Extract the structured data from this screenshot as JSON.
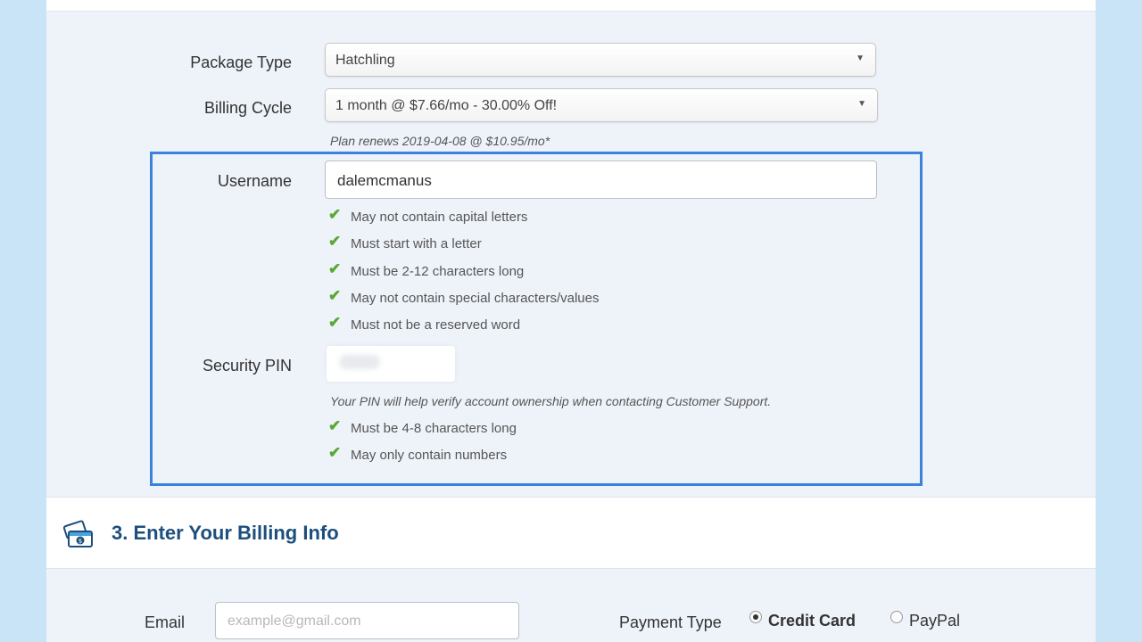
{
  "form": {
    "package_type_label": "Package Type",
    "package_type_value": "Hatchling",
    "billing_cycle_label": "Billing Cycle",
    "billing_cycle_value": "1 month @ $7.66/mo - 30.00% Off!",
    "renew_note": "Plan renews 2019-04-08 @ $10.95/mo*",
    "dropdown_glyph": "▼"
  },
  "account": {
    "username_label": "Username",
    "username_value": "dalemcmanus",
    "username_rules": [
      "May not contain capital letters",
      "Must start with a letter",
      "Must be 2-12 characters long",
      "May not contain special characters/values",
      "Must not be a reserved word"
    ],
    "pin_label": "Security PIN",
    "pin_note": "Your PIN will help verify account ownership when contacting Customer Support.",
    "pin_rules": [
      "Must be 4-8 characters long",
      "May only contain numbers"
    ],
    "check_glyph": "✔",
    "check_color": "#5aa832",
    "highlight_color": "#3b82dc"
  },
  "billing": {
    "section_title": "3. Enter Your Billing Info",
    "section_icon": "billing-cards-icon",
    "email_label": "Email",
    "email_placeholder": "example@gmail.com",
    "payment_type_label": "Payment Type",
    "payment_options": [
      "Credit Card",
      "PayPal"
    ],
    "payment_selected": "Credit Card",
    "title_color": "#1c4f7d"
  }
}
